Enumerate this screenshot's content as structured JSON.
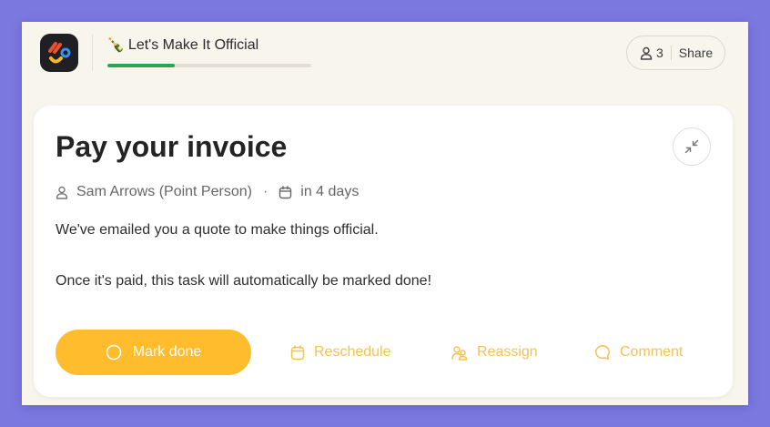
{
  "project": {
    "emoji": "🍾",
    "title": "Let's Make It Official",
    "progress": 0.33
  },
  "share": {
    "member_count": "3",
    "label": "Share"
  },
  "task": {
    "title": "Pay your invoice",
    "assignee": "Sam Arrows (Point Person)",
    "separator": "·",
    "due": "in 4 days",
    "description": [
      "We've emailed you a quote to make things official.",
      "Once it's paid, this task will automatically be marked done!"
    ]
  },
  "actions": {
    "mark_done": "Mark done",
    "reschedule": "Reschedule",
    "reassign": "Reassign",
    "comment": "Comment"
  },
  "icons": {
    "app_logo": "app-logo",
    "members": "person-icon",
    "collapse": "collapse-arrows-icon",
    "assignee": "person-icon",
    "due": "calendar-icon",
    "mark_done": "circle-icon",
    "reschedule": "calendar-icon",
    "reassign": "people-icon",
    "comment": "chat-bubble-icon"
  },
  "colors": {
    "page_background": "#7b79e0",
    "panel_background": "#f8f5ec",
    "card_background": "#ffffff",
    "progress": "#2aa851",
    "primary_button": "#ffbd2e",
    "action_text": "#f7c153"
  }
}
